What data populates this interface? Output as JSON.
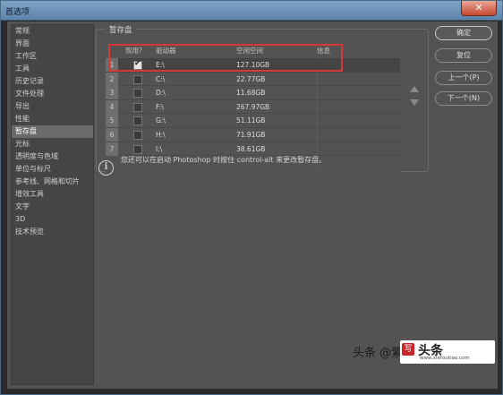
{
  "window": {
    "title": "首选项",
    "close_glyph": "✕"
  },
  "sidebar": {
    "items": [
      {
        "label": "常规"
      },
      {
        "label": "界面"
      },
      {
        "label": "工作区"
      },
      {
        "label": "工具"
      },
      {
        "label": "历史记录"
      },
      {
        "label": "文件处理"
      },
      {
        "label": "导出"
      },
      {
        "label": "性能"
      },
      {
        "label": "暂存盘",
        "active": true
      },
      {
        "label": "光标"
      },
      {
        "label": "透明度与色域"
      },
      {
        "label": "单位与标尺"
      },
      {
        "label": "参考线、网格和切片"
      },
      {
        "label": "增效工具"
      },
      {
        "label": "文字"
      },
      {
        "label": "3D"
      },
      {
        "label": "技术预览"
      }
    ]
  },
  "scratch": {
    "group_label": "暂存盘",
    "headers": {
      "active": "现用?",
      "drive": "驱动器",
      "free": "空闲空间",
      "info": "信息"
    },
    "rows": [
      {
        "num": "1",
        "checked": true,
        "drive": "E:\\",
        "free": "127.10GB",
        "info": ""
      },
      {
        "num": "2",
        "checked": false,
        "drive": "C:\\",
        "free": "22.77GB",
        "info": ""
      },
      {
        "num": "3",
        "checked": false,
        "drive": "D:\\",
        "free": "11.68GB",
        "info": ""
      },
      {
        "num": "4",
        "checked": false,
        "drive": "F:\\",
        "free": "267.97GB",
        "info": ""
      },
      {
        "num": "5",
        "checked": false,
        "drive": "G:\\",
        "free": "51.11GB",
        "info": ""
      },
      {
        "num": "6",
        "checked": false,
        "drive": "H:\\",
        "free": "71.91GB",
        "info": ""
      },
      {
        "num": "7",
        "checked": false,
        "drive": "I:\\",
        "free": "38.61GB",
        "info": ""
      }
    ],
    "info_text": "您还可以在启动 Photoshop 时按住 control-alt 来更改暂存盘。",
    "highlight_color": "#d43838"
  },
  "buttons": {
    "ok": "确定",
    "reset": "复位",
    "prev": "上一个(P)",
    "next": "下一个(N)"
  },
  "watermark": {
    "text": "头条 @紫",
    "logo_char": "写",
    "logo_text": "头条",
    "url": "www.xietoutiao.com"
  }
}
